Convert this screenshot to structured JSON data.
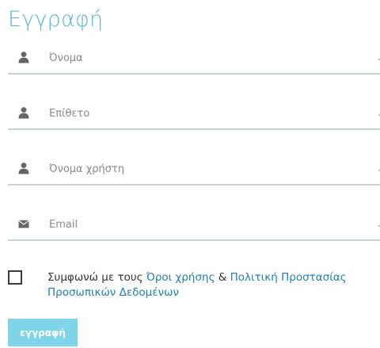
{
  "form": {
    "title": "Εγγραφή",
    "fields": [
      {
        "placeholder": "Όνομα",
        "icon": "user-icon"
      },
      {
        "placeholder": "Επίθετο",
        "icon": "user-icon"
      },
      {
        "placeholder": "Όνομα χρήστη",
        "icon": "user-icon"
      },
      {
        "placeholder": "Email",
        "icon": "envelope-icon"
      }
    ],
    "terms": {
      "prefix": "Συμφωνώ με τους ",
      "link_terms": "Όροι χρήσης",
      "middle": " & ",
      "link_privacy": "Πολιτική Προστασίας Προσωπικών Δεδομένων"
    },
    "submit_label": "εγγραφή"
  },
  "colors": {
    "title": "#55b6d6",
    "link": "#1e7fb4",
    "button": "#7fd4e8",
    "underline": "#c8d0d6",
    "icon": "#666666"
  }
}
